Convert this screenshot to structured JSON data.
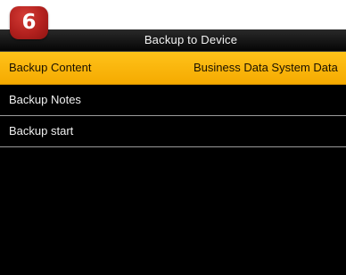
{
  "step_badge": "6",
  "title_bar": {
    "title": "Backup to Device"
  },
  "menu": {
    "items": [
      {
        "label": "Backup Content",
        "value": "Business Data System Data",
        "selected": true
      },
      {
        "label": "Backup Notes",
        "value": "",
        "selected": false
      },
      {
        "label": "Backup start",
        "value": "",
        "selected": false
      }
    ]
  },
  "colors": {
    "screen_background": "#000000",
    "selected_highlight": "#f7b100",
    "badge": "#b3211e",
    "text": "#f0f0f0"
  }
}
